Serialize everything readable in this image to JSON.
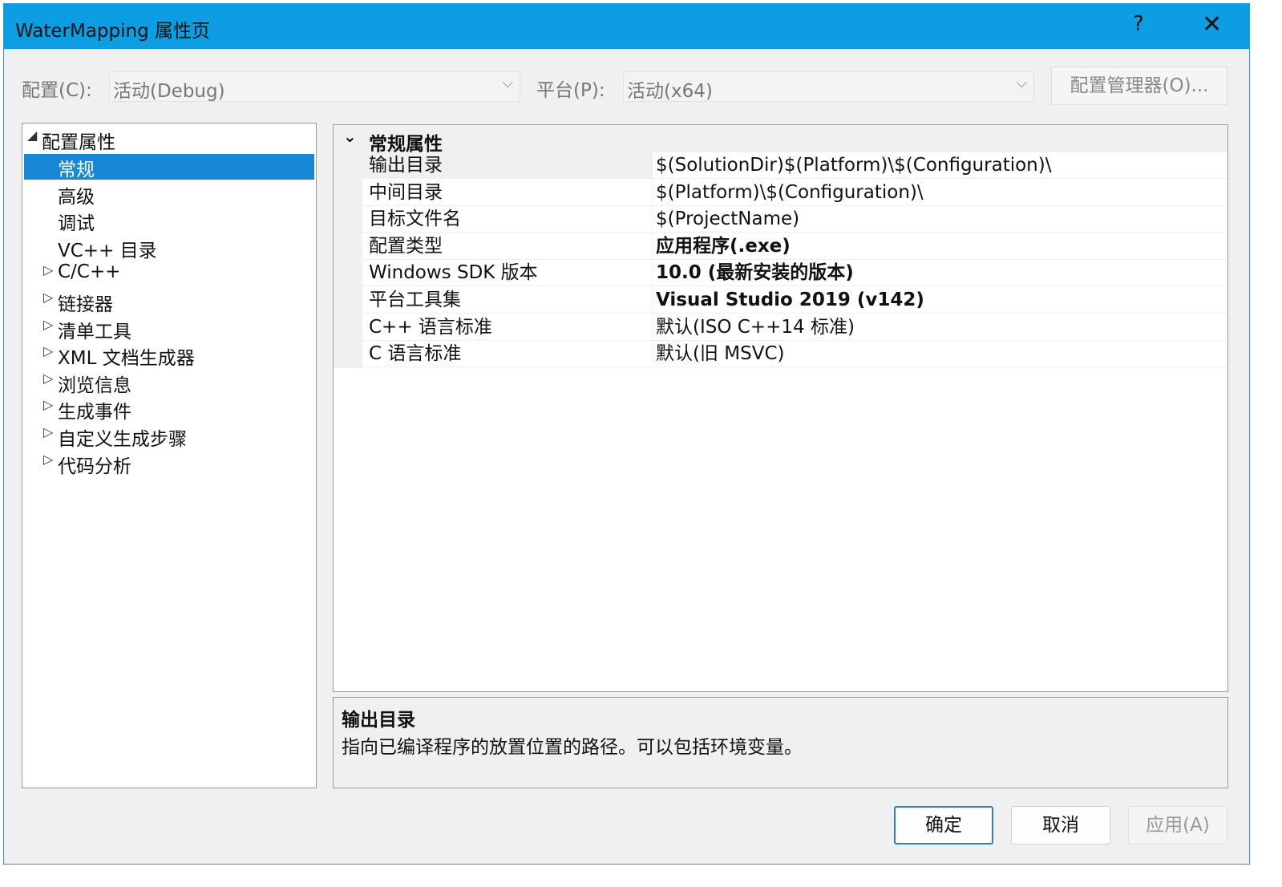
{
  "window": {
    "title": "WaterMapping 属性页",
    "help_label": "?",
    "close_label": "✕"
  },
  "toolbar": {
    "config_label": "配置(C):",
    "config_value": "活动(Debug)",
    "platform_label": "平台(P):",
    "platform_value": "活动(x64)",
    "manager_label": "配置管理器(O)...",
    "dropdown_glyph": "⌵"
  },
  "tree": {
    "root_expander": "◢",
    "collapsed_expander": "▷",
    "root": "配置属性",
    "items": [
      {
        "label": "常规",
        "selected": true
      },
      {
        "label": "高级"
      },
      {
        "label": "调试"
      },
      {
        "label": "VC++ 目录"
      },
      {
        "label": "C/C++",
        "expandable": true
      },
      {
        "label": "链接器",
        "expandable": true
      },
      {
        "label": "清单工具",
        "expandable": true
      },
      {
        "label": "XML 文档生成器",
        "expandable": true
      },
      {
        "label": "浏览信息",
        "expandable": true
      },
      {
        "label": "生成事件",
        "expandable": true
      },
      {
        "label": "自定义生成步骤",
        "expandable": true
      },
      {
        "label": "代码分析",
        "expandable": true
      }
    ]
  },
  "grid": {
    "section_chevron": "⌄",
    "section_title": "常规属性",
    "rows": [
      {
        "name": "输出目录",
        "value": "$(SolutionDir)$(Platform)\\$(Configuration)\\",
        "bold": false
      },
      {
        "name": "中间目录",
        "value": "$(Platform)\\$(Configuration)\\",
        "bold": false
      },
      {
        "name": "目标文件名",
        "value": "$(ProjectName)",
        "bold": false
      },
      {
        "name": "配置类型",
        "value": "应用程序(.exe)",
        "bold": true
      },
      {
        "name": "Windows SDK 版本",
        "value": "10.0 (最新安装的版本)",
        "bold": true
      },
      {
        "name": "平台工具集",
        "value": "Visual Studio 2019 (v142)",
        "bold": true
      },
      {
        "name": "C++ 语言标准",
        "value": "默认(ISO C++14 标准)",
        "bold": false
      },
      {
        "name": "C 语言标准",
        "value": "默认(旧 MSVC)",
        "bold": false
      }
    ]
  },
  "description": {
    "title": "输出目录",
    "text": "指向已编译程序的放置位置的路径。可以包括环境变量。"
  },
  "buttons": {
    "ok": "确定",
    "cancel": "取消",
    "apply": "应用(A)"
  }
}
